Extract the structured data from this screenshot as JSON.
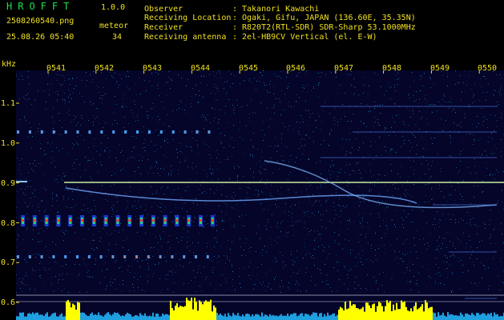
{
  "header": {
    "app_name": "HROFFT",
    "version": "1.0.0",
    "filename": "2508260540.png",
    "datetime": "25.08.26 05:40",
    "meteor_label": "meteor",
    "meteor_count": "34",
    "fields": [
      {
        "label": "Observer",
        "value": "Takanori Kawachi"
      },
      {
        "label": "Receiving Location",
        "value": "Ogaki, Gifu, JAPAN (136.60E, 35.35N)"
      },
      {
        "label": "Receiver",
        "value": "R820T2(RTL-SDR) SDR-Sharp 53.1000MHz"
      },
      {
        "label": "Receiving antenna",
        "value": "2el-HB9CV Vertical (el. E-W)"
      }
    ],
    "separator": ":"
  },
  "axes": {
    "y_unit": "kHz",
    "x_ticks": [
      "0541",
      "0542",
      "0543",
      "0544",
      "0545",
      "0546",
      "0547",
      "0548",
      "0549",
      "0550"
    ],
    "y_ticks": [
      "1.1",
      "1.0",
      "0.9",
      "0.8",
      "0.7",
      "0.6"
    ]
  },
  "colors": {
    "background": "#05052a",
    "text_yellow": "#f0e020",
    "title_green": "#19e34a",
    "level_bar": "#ffff00",
    "noise": "#1e9fe0"
  }
}
